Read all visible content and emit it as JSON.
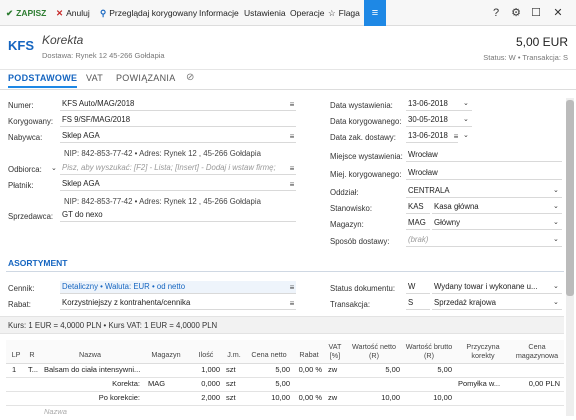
{
  "toolbar": {
    "save": "ZAPISZ",
    "cancel": "Anuluj",
    "browse": "Przeglądaj korygowany",
    "info": "Informacje",
    "settings": "Ustawienia",
    "operations": "Operacje",
    "flag": "Flaga",
    "menu_icon": "hamburger-icon",
    "help": "?",
    "colors": {
      "save": "#2e7d32",
      "cancel": "#c62828",
      "accent": "#1e88e5"
    }
  },
  "header": {
    "badge": "KFS",
    "title": "Korekta",
    "address": "Dostawa: Rynek 12  45-266 Gołdapia",
    "amount": "5,00 EUR",
    "status": "Status:  W  •  Transakcja:  S"
  },
  "tabs": [
    "PODSTAWOWE",
    "VAT",
    "POWIĄZANIA"
  ],
  "left": {
    "numer_label": "Numer:",
    "numer": "KFS Auto/MAG/2018",
    "korygowany_label": "Korygowany:",
    "korygowany": "FS 9/SF/MAG/2018",
    "nabywca_label": "Nabywca:",
    "nabywca": "Sklep AGA",
    "nabywca_info": "NIP:  842-853-77-42  •  Adres:  Rynek 12 , 45-266 Gołdapia",
    "odbiorca_label": "Odbiorca:",
    "odbiorca_placeholder": "Pisz, aby wyszukać: [F2] - Lista; [Insert] - Dodaj i wstaw firmę;",
    "platnik_label": "Płatnik:",
    "platnik": "Sklep AGA",
    "platnik_info": "NIP:  842-853-77-42  •  Adres:  Rynek 12 , 45-266 Gołdapia",
    "sprzedawca_label": "Sprzedawca:",
    "sprzedawca": "GT do nexo"
  },
  "right": {
    "data_wyst_label": "Data wystawienia:",
    "data_wyst": "13-06-2018",
    "data_kor_label": "Data korygowanego:",
    "data_kor": "30-05-2018",
    "data_zak_label": "Data zak. dostawy:",
    "data_zak": "13-06-2018",
    "miejsce_label": "Miejsce wystawienia:",
    "miejsce": "Wrocław",
    "miejsce_kor_label": "Miej. korygowanego:",
    "miejsce_kor": "Wrocław",
    "oddzial_label": "Oddział:",
    "oddzial": "CENTRALA",
    "stanowisko_label": "Stanowisko:",
    "stanowisko_code": "KAS",
    "stanowisko": "Kasa główna",
    "magazyn_label": "Magazyn:",
    "magazyn_code": "MAG",
    "magazyn": "Główny",
    "sposob_label": "Sposób dostawy:",
    "sposob": "(brak)"
  },
  "asortyment": {
    "title": "ASORTYMENT",
    "cennik_label": "Cennik:",
    "cennik": "Detaliczny • Waluta: EUR • od netto",
    "rabat_label": "Rabat:",
    "rabat": "Korzystniejszy z kontrahenta/cennika",
    "status_label": "Status dokumentu:",
    "status_code": "W",
    "status": "Wydany towar i wykonane u...",
    "transakcja_label": "Transakcja:",
    "transakcja_code": "S",
    "transakcja": "Sprzedaż krajowa",
    "kurs": "Kurs: 1 EUR = 4,0000 PLN   •   Kurs VAT: 1 EUR = 4,0000 PLN"
  },
  "table": {
    "headers": [
      "LP",
      "R",
      "Nazwa",
      "Magazyn",
      "Ilość",
      "J.m.",
      "Cena netto",
      "Rabat",
      "VAT [%]",
      "Wartość netto (R)",
      "Wartość brutto (R)",
      "Przyczyna korekty",
      "Cena magazynowa"
    ],
    "rows": [
      [
        "1",
        "T...",
        "Balsam do ciała intensywni...",
        "",
        "1,000",
        "szt",
        "5,00",
        "0,00 %",
        "zw",
        "5,00",
        "5,00",
        "",
        ""
      ],
      [
        "",
        "",
        "Korekta:",
        "MAG",
        "0,000",
        "szt",
        "5,00",
        "",
        "",
        "",
        "",
        "Pomyłka w...",
        "0,00 PLN"
      ],
      [
        "",
        "",
        "Po korekcie:",
        "",
        "2,000",
        "szt",
        "10,00",
        "0,00 %",
        "zw",
        "10,00",
        "10,00",
        "",
        ""
      ]
    ],
    "name_placeholder": "Nazwa"
  }
}
